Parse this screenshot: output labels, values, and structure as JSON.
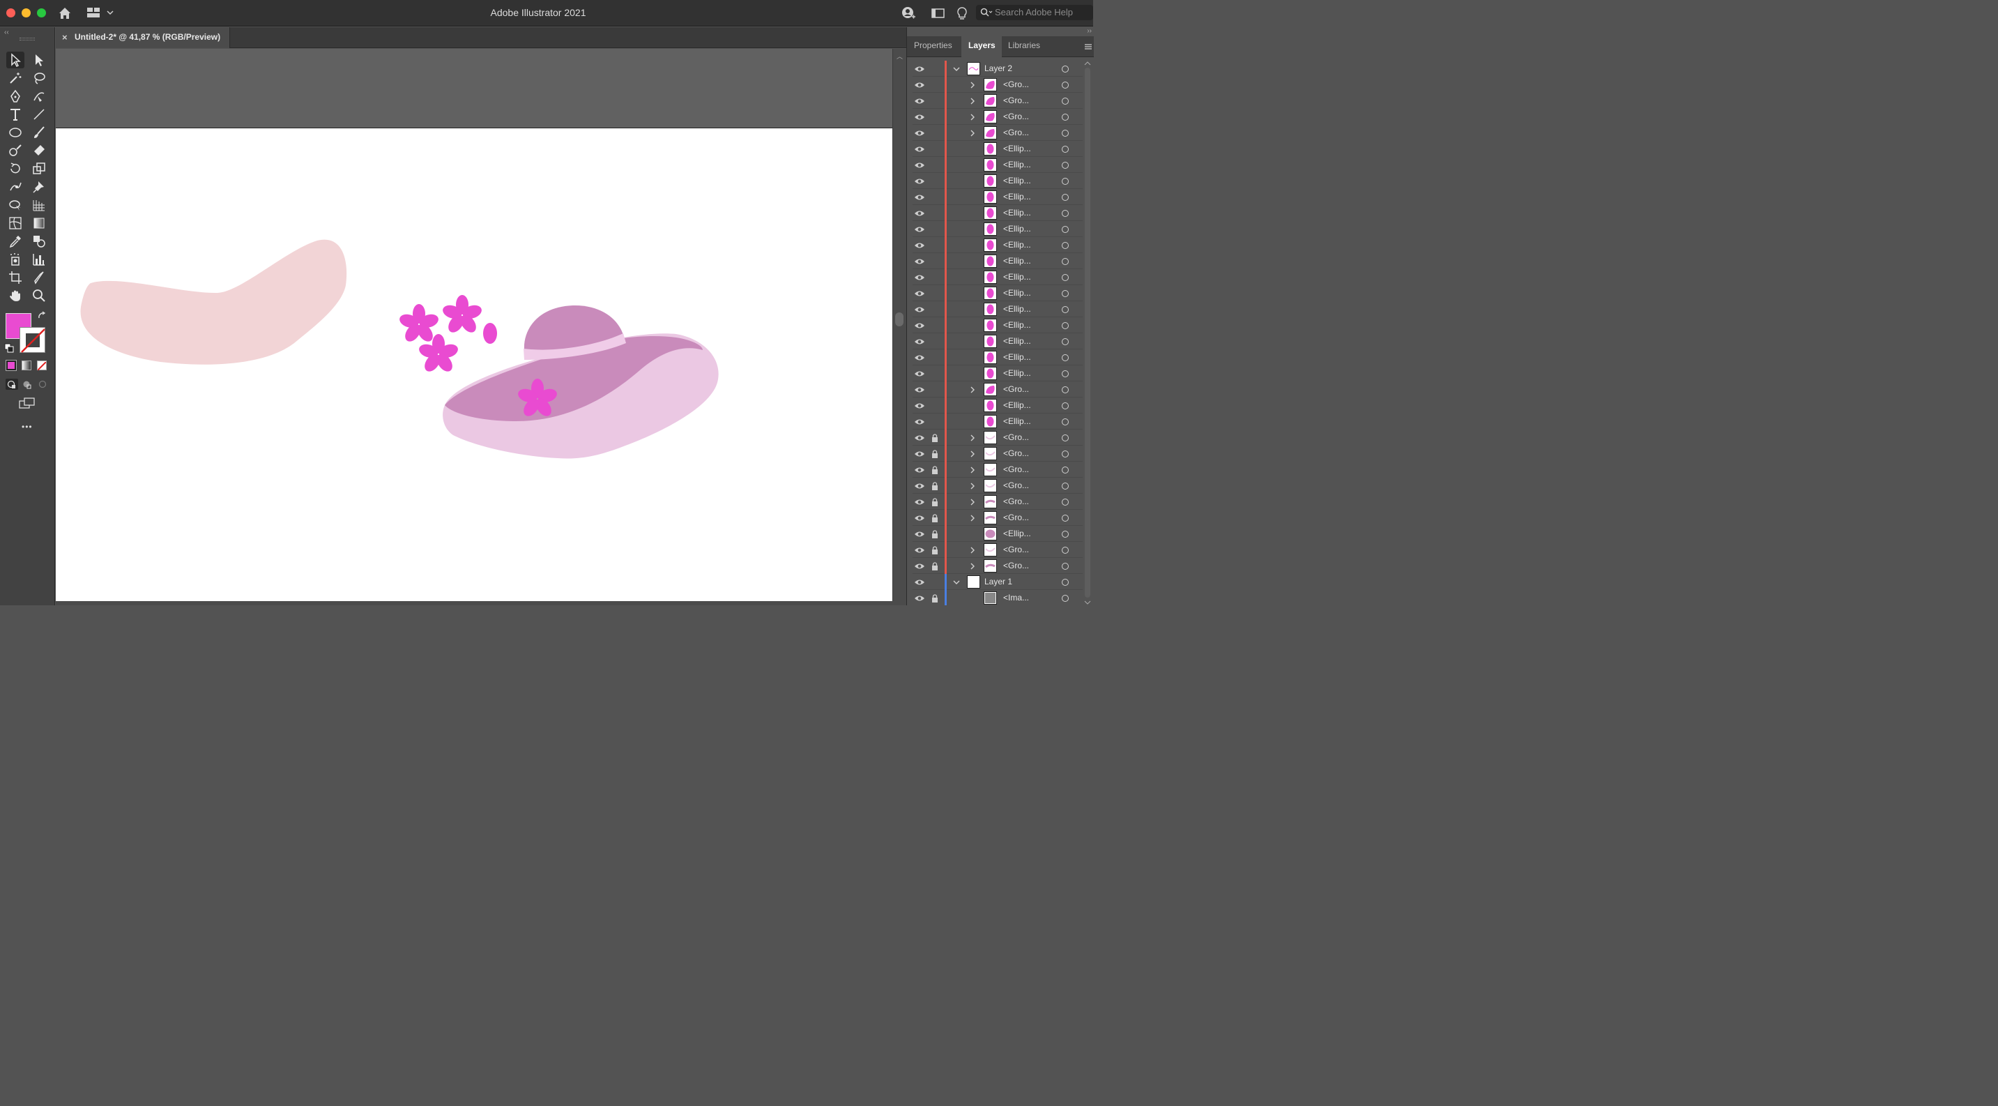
{
  "window": {
    "title": "Adobe Illustrator 2021",
    "search_placeholder": "Search Adobe Help"
  },
  "document": {
    "tab_label": "Untitled-2* @ 41,87 % (RGB/Preview)",
    "close_glyph": "×"
  },
  "toolbar": {
    "tools": [
      "selection",
      "direct-selection",
      "magic-wand",
      "lasso",
      "pen",
      "curvature",
      "type",
      "line-segment",
      "ellipse",
      "paintbrush",
      "shaper",
      "eraser",
      "rotate",
      "scale",
      "puppet-warp",
      "pin",
      "free-transform",
      "perspective-grid",
      "mesh",
      "gradient",
      "eyedropper",
      "blend",
      "symbol-sprayer",
      "column-graph",
      "artboard",
      "slice",
      "hand",
      "zoom"
    ],
    "fill_color": "#e94bd1",
    "stroke": "none",
    "more_glyph": "•••"
  },
  "panel": {
    "tabs": [
      "Properties",
      "Layers",
      "Libraries"
    ],
    "active_tab": "Layers",
    "layers": [
      {
        "name": "Layer 2",
        "level": 0,
        "expanded": true,
        "locked": false,
        "thumb": "layer",
        "color": "#e2574c"
      },
      {
        "name": "<Gro...",
        "level": 1,
        "expandable": true,
        "locked": false,
        "thumb": "pink-blob"
      },
      {
        "name": "<Gro...",
        "level": 1,
        "expandable": true,
        "locked": false,
        "thumb": "pink-blob"
      },
      {
        "name": "<Gro...",
        "level": 1,
        "expandable": true,
        "locked": false,
        "thumb": "pink-blob"
      },
      {
        "name": "<Gro...",
        "level": 1,
        "expandable": true,
        "locked": false,
        "thumb": "pink-blob"
      },
      {
        "name": "<Ellip...",
        "level": 1,
        "expandable": false,
        "locked": false,
        "thumb": "pink-oval"
      },
      {
        "name": "<Ellip...",
        "level": 1,
        "expandable": false,
        "locked": false,
        "thumb": "pink-oval"
      },
      {
        "name": "<Ellip...",
        "level": 1,
        "expandable": false,
        "locked": false,
        "thumb": "pink-oval"
      },
      {
        "name": "<Ellip...",
        "level": 1,
        "expandable": false,
        "locked": false,
        "thumb": "pink-oval"
      },
      {
        "name": "<Ellip...",
        "level": 1,
        "expandable": false,
        "locked": false,
        "thumb": "pink-oval"
      },
      {
        "name": "<Ellip...",
        "level": 1,
        "expandable": false,
        "locked": false,
        "thumb": "pink-oval"
      },
      {
        "name": "<Ellip...",
        "level": 1,
        "expandable": false,
        "locked": false,
        "thumb": "pink-oval"
      },
      {
        "name": "<Ellip...",
        "level": 1,
        "expandable": false,
        "locked": false,
        "thumb": "pink-oval"
      },
      {
        "name": "<Ellip...",
        "level": 1,
        "expandable": false,
        "locked": false,
        "thumb": "pink-oval"
      },
      {
        "name": "<Ellip...",
        "level": 1,
        "expandable": false,
        "locked": false,
        "thumb": "pink-oval"
      },
      {
        "name": "<Ellip...",
        "level": 1,
        "expandable": false,
        "locked": false,
        "thumb": "pink-oval"
      },
      {
        "name": "<Ellip...",
        "level": 1,
        "expandable": false,
        "locked": false,
        "thumb": "pink-oval"
      },
      {
        "name": "<Ellip...",
        "level": 1,
        "expandable": false,
        "locked": false,
        "thumb": "pink-oval"
      },
      {
        "name": "<Ellip...",
        "level": 1,
        "expandable": false,
        "locked": false,
        "thumb": "pink-oval"
      },
      {
        "name": "<Ellip...",
        "level": 1,
        "expandable": false,
        "locked": false,
        "thumb": "pink-oval"
      },
      {
        "name": "<Gro...",
        "level": 1,
        "expandable": true,
        "locked": false,
        "thumb": "pink-blob"
      },
      {
        "name": "<Ellip...",
        "level": 1,
        "expandable": false,
        "locked": false,
        "thumb": "pink-oval"
      },
      {
        "name": "<Ellip...",
        "level": 1,
        "expandable": false,
        "locked": false,
        "thumb": "pink-oval"
      },
      {
        "name": "<Gro...",
        "level": 1,
        "expandable": true,
        "locked": true,
        "thumb": "light-stroke"
      },
      {
        "name": "<Gro...",
        "level": 1,
        "expandable": true,
        "locked": true,
        "thumb": "light-stroke"
      },
      {
        "name": "<Gro...",
        "level": 1,
        "expandable": true,
        "locked": true,
        "thumb": "light-stroke"
      },
      {
        "name": "<Gro...",
        "level": 1,
        "expandable": true,
        "locked": true,
        "thumb": "light-stroke"
      },
      {
        "name": "<Gro...",
        "level": 1,
        "expandable": true,
        "locked": true,
        "thumb": "mauve-stroke"
      },
      {
        "name": "<Gro...",
        "level": 1,
        "expandable": true,
        "locked": true,
        "thumb": "mauve-stroke"
      },
      {
        "name": "<Ellip...",
        "level": 1,
        "expandable": false,
        "locked": true,
        "thumb": "mauve-oval"
      },
      {
        "name": "<Gro...",
        "level": 1,
        "expandable": true,
        "locked": true,
        "thumb": "light-stroke"
      },
      {
        "name": "<Gro...",
        "level": 1,
        "expandable": true,
        "locked": true,
        "thumb": "mauve-stroke"
      },
      {
        "name": "Layer 1",
        "level": 0,
        "expanded": true,
        "locked": false,
        "thumb": "blank",
        "color": "#4a7fe2"
      },
      {
        "name": "<Ima...",
        "level": 1,
        "expandable": false,
        "locked": true,
        "thumb": "image"
      }
    ]
  },
  "artwork": {
    "colors": {
      "blob": "#f2d4d6",
      "flower": "#e94bd1",
      "hat_crown": "#c98bbb",
      "hat_brim": "#ebc8e3",
      "hat_band": "#f0cce8"
    }
  }
}
